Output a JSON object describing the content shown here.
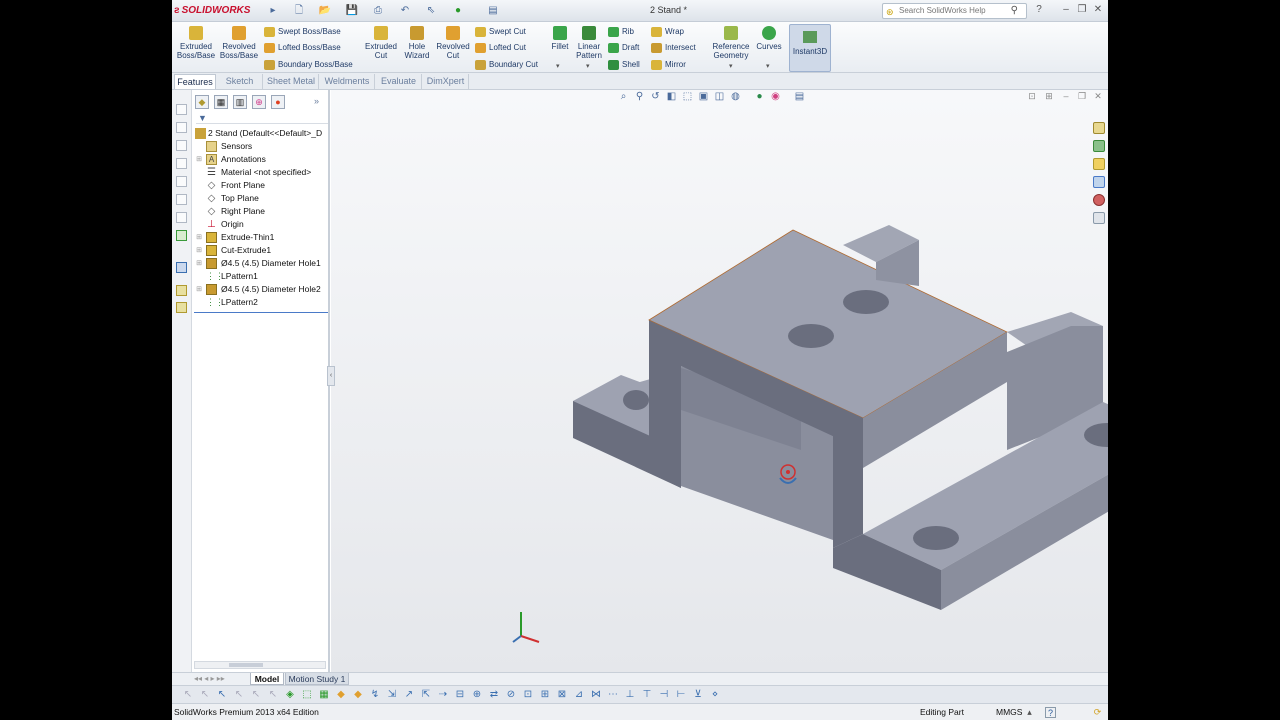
{
  "app": {
    "logo_text": "SOLIDWORKS",
    "document_title": "2 Stand *",
    "search_placeholder": "Search SolidWorks Help"
  },
  "command_manager": {
    "big_buttons": [
      {
        "label_1": "Extruded",
        "label_2": "Boss/Base",
        "icon": "extruded-boss-icon"
      },
      {
        "label_1": "Revolved",
        "label_2": "Boss/Base",
        "icon": "revolved-boss-icon"
      },
      {
        "label_1": "Extruded",
        "label_2": "Cut",
        "icon": "extruded-cut-icon"
      },
      {
        "label_1": "Hole",
        "label_2": "Wizard",
        "icon": "hole-wizard-icon"
      },
      {
        "label_1": "Revolved",
        "label_2": "Cut",
        "icon": "revolved-cut-icon"
      },
      {
        "label_1": "Fillet",
        "label_2": "",
        "icon": "fillet-icon"
      },
      {
        "label_1": "Linear",
        "label_2": "Pattern",
        "icon": "linear-pattern-icon"
      },
      {
        "label_1": "Reference",
        "label_2": "Geometry",
        "icon": "reference-geometry-icon"
      },
      {
        "label_1": "Curves",
        "label_2": "",
        "icon": "curves-icon"
      }
    ],
    "boss_column": [
      "Swept Boss/Base",
      "Lofted Boss/Base",
      "Boundary Boss/Base"
    ],
    "cut_column": [
      "Swept Cut",
      "Lofted Cut",
      "Boundary Cut"
    ],
    "features_column": [
      "Rib",
      "Draft",
      "Shell"
    ],
    "features_column_2": [
      "Wrap",
      "Intersect",
      "Mirror"
    ],
    "instant3d_label": "Instant3D"
  },
  "tabs": [
    {
      "label": "Features",
      "active": true
    },
    {
      "label": "Sketch",
      "active": false
    },
    {
      "label": "Sheet Metal",
      "active": false
    },
    {
      "label": "Weldments",
      "active": false
    },
    {
      "label": "Evaluate",
      "active": false
    },
    {
      "label": "DimXpert",
      "active": false
    }
  ],
  "feature_tree": {
    "root": "2 Stand  (Default<<Default>_D",
    "items": [
      {
        "label": "Sensors",
        "icon": "sensors-icon",
        "expandable": false
      },
      {
        "label": "Annotations",
        "icon": "annotations-icon",
        "expandable": true
      },
      {
        "label": "Material <not specified>",
        "icon": "material-icon",
        "expandable": false
      },
      {
        "label": "Front Plane",
        "icon": "plane-icon",
        "expandable": false
      },
      {
        "label": "Top Plane",
        "icon": "plane-icon",
        "expandable": false
      },
      {
        "label": "Right Plane",
        "icon": "plane-icon",
        "expandable": false
      },
      {
        "label": "Origin",
        "icon": "origin-icon",
        "expandable": false
      },
      {
        "label": "Extrude-Thin1",
        "icon": "extrude-icon",
        "expandable": true
      },
      {
        "label": "Cut-Extrude1",
        "icon": "cut-extrude-icon",
        "expandable": true
      },
      {
        "label": "Ø4.5 (4.5) Diameter Hole1",
        "icon": "hole-icon",
        "expandable": true
      },
      {
        "label": "LPattern1",
        "icon": "pattern-icon",
        "expandable": false
      },
      {
        "label": "Ø4.5 (4.5) Diameter Hole2",
        "icon": "hole-icon",
        "expandable": true
      },
      {
        "label": "LPattern2",
        "icon": "pattern-icon",
        "expandable": false
      }
    ]
  },
  "model_tabs": [
    {
      "label": "Model",
      "active": true
    },
    {
      "label": "Motion Study 1",
      "active": false
    }
  ],
  "status_bar": {
    "product": "SolidWorks Premium 2013 x64 Edition",
    "mode": "Editing Part",
    "units": "MMGS"
  },
  "colors": {
    "part_top": "#9ea2b1",
    "part_front": "#6a6e7e",
    "part_side": "#8a8e9d",
    "accent": "#c8102e"
  }
}
